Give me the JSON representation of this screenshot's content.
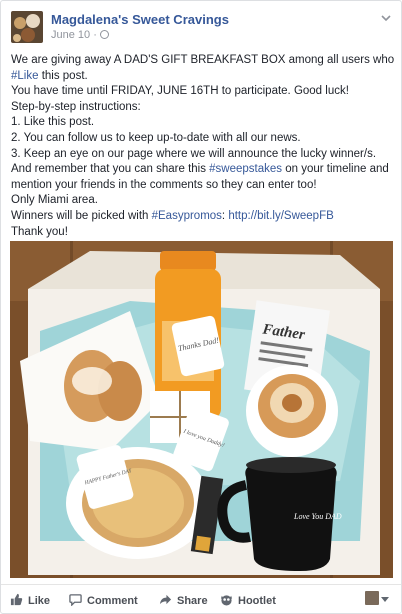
{
  "post": {
    "page_name": "Magdalena's Sweet Cravings",
    "date": "June 10"
  },
  "body": {
    "l1": "We are giving away A DAD'S GIFT BREAKFAST BOX among all users who",
    "l2_tag": "#Like",
    "l2_rest": " this post.",
    "l3": "You have time until FRIDAY, JUNE 16TH to participate. Good luck!",
    "l4": "Step-by-step instructions:",
    "l5": "1. Like this post.",
    "l6": "2. You can follow us to keep up-to-date with all our news.",
    "l7": "3. Keep an eye on our page where we will announce the lucky winner/s.",
    "l8_pre": "And remember that you can share this ",
    "l8_tag": "#sweepstakes",
    "l8_post": " on your timeline and",
    "l9": "mention your friends in the comments so they can enter too!",
    "l10": "Only Miami area.",
    "l11_pre": "Winners will be picked with ",
    "l11_tag": "#Easypromos",
    "l11_mid": ": ",
    "l11_link": "http://bit.ly/SweepFB",
    "l12": "Thank you!"
  },
  "photo": {
    "tag_thanks": "Thanks Dad!",
    "card_father": "Father",
    "tag_happy": "HAPPY Father's DAY",
    "tag_love": "I love you Daddy!",
    "mug_text": "Love You DAD"
  },
  "actions": {
    "like": "Like",
    "comment": "Comment",
    "share": "Share",
    "hootlet": "Hootlet"
  },
  "colors": {
    "link": "#365899",
    "text": "#1d2129",
    "meta": "#90949c"
  }
}
